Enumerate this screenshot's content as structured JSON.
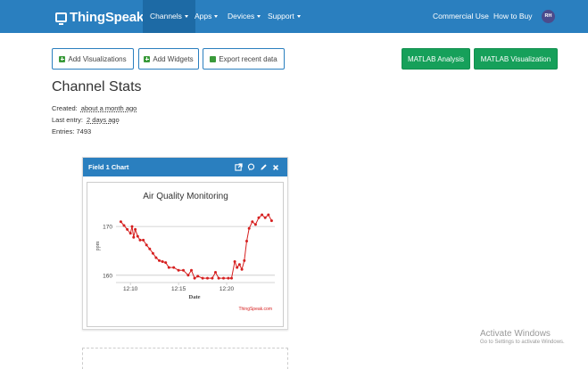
{
  "navbar": {
    "brand": "ThingSpeak",
    "brand_tm": "™",
    "items": [
      {
        "label": "Channels",
        "active": true
      },
      {
        "label": "Apps"
      },
      {
        "label": "Devices"
      },
      {
        "label": "Support"
      }
    ],
    "right_items": [
      {
        "label": "Commercial Use"
      },
      {
        "label": "How to Buy"
      }
    ],
    "avatar_initials": "RH"
  },
  "toolbar": {
    "add_visualizations": "Add Visualizations",
    "add_widgets": "Add Widgets",
    "export_recent_data": "Export recent data",
    "matlab_analysis": "MATLAB Analysis",
    "matlab_visualization": "MATLAB Visualization"
  },
  "channel_stats": {
    "title": "Channel Stats",
    "created_label": "Created:",
    "created_value": "about a month ago",
    "last_entry_label": "Last entry:",
    "last_entry_value": "2 days ago",
    "entries_label": "Entries: 7493"
  },
  "panel": {
    "title": "Field 1 Chart",
    "icons": [
      "external-link-icon",
      "comment-icon",
      "pencil-icon",
      "close-icon"
    ]
  },
  "chart_data": {
    "type": "line",
    "title": "Air Quality Monitoring",
    "xlabel": "Date",
    "ylabel": "ppm",
    "credit": "ThingSpeak.com",
    "x_ticks": [
      "12:10",
      "12:15",
      "12:20"
    ],
    "y_ticks": [
      160,
      170
    ],
    "ylim": [
      158.5,
      173.5
    ],
    "series_color": "#d62020",
    "points": [
      [
        "12:09:00",
        171
      ],
      [
        "12:09:20",
        170.2
      ],
      [
        "12:09:40",
        169.4
      ],
      [
        "12:10:00",
        168.6
      ],
      [
        "12:10:10",
        170
      ],
      [
        "12:10:20",
        167.8
      ],
      [
        "12:10:30",
        169.4
      ],
      [
        "12:10:45",
        168
      ],
      [
        "12:11:00",
        167.2
      ],
      [
        "12:11:20",
        167.2
      ],
      [
        "12:11:40",
        166.2
      ],
      [
        "12:12:00",
        165.4
      ],
      [
        "12:12:20",
        164.5
      ],
      [
        "12:12:40",
        163.6
      ],
      [
        "12:13:00",
        163
      ],
      [
        "12:13:20",
        162.8
      ],
      [
        "12:13:40",
        162.6
      ],
      [
        "12:14:00",
        161.6
      ],
      [
        "12:14:30",
        161.6
      ],
      [
        "12:15:00",
        161
      ],
      [
        "12:15:30",
        161
      ],
      [
        "12:16:00",
        160
      ],
      [
        "12:16:20",
        161
      ],
      [
        "12:16:40",
        159.4
      ],
      [
        "12:17:00",
        159.8
      ],
      [
        "12:17:30",
        159.4
      ],
      [
        "12:18:00",
        159.4
      ],
      [
        "12:18:30",
        159.4
      ],
      [
        "12:18:50",
        160.6
      ],
      [
        "12:19:10",
        159.4
      ],
      [
        "12:19:40",
        159.4
      ],
      [
        "12:20:10",
        159.4
      ],
      [
        "12:20:30",
        159.4
      ],
      [
        "12:20:50",
        162.8
      ],
      [
        "12:21:05",
        161.6
      ],
      [
        "12:21:20",
        162.2
      ],
      [
        "12:21:35",
        161.2
      ],
      [
        "12:21:50",
        163
      ],
      [
        "12:22:05",
        167
      ],
      [
        "12:22:20",
        169.6
      ],
      [
        "12:22:40",
        171
      ],
      [
        "12:23:00",
        170.4
      ],
      [
        "12:23:20",
        171.8
      ],
      [
        "12:23:40",
        172.4
      ],
      [
        "12:24:00",
        171.8
      ],
      [
        "12:24:20",
        172.4
      ],
      [
        "12:24:40",
        171.2
      ]
    ]
  },
  "watermark": {
    "title": "Activate Windows",
    "subtitle": "Go to Settings to activate Windows."
  }
}
